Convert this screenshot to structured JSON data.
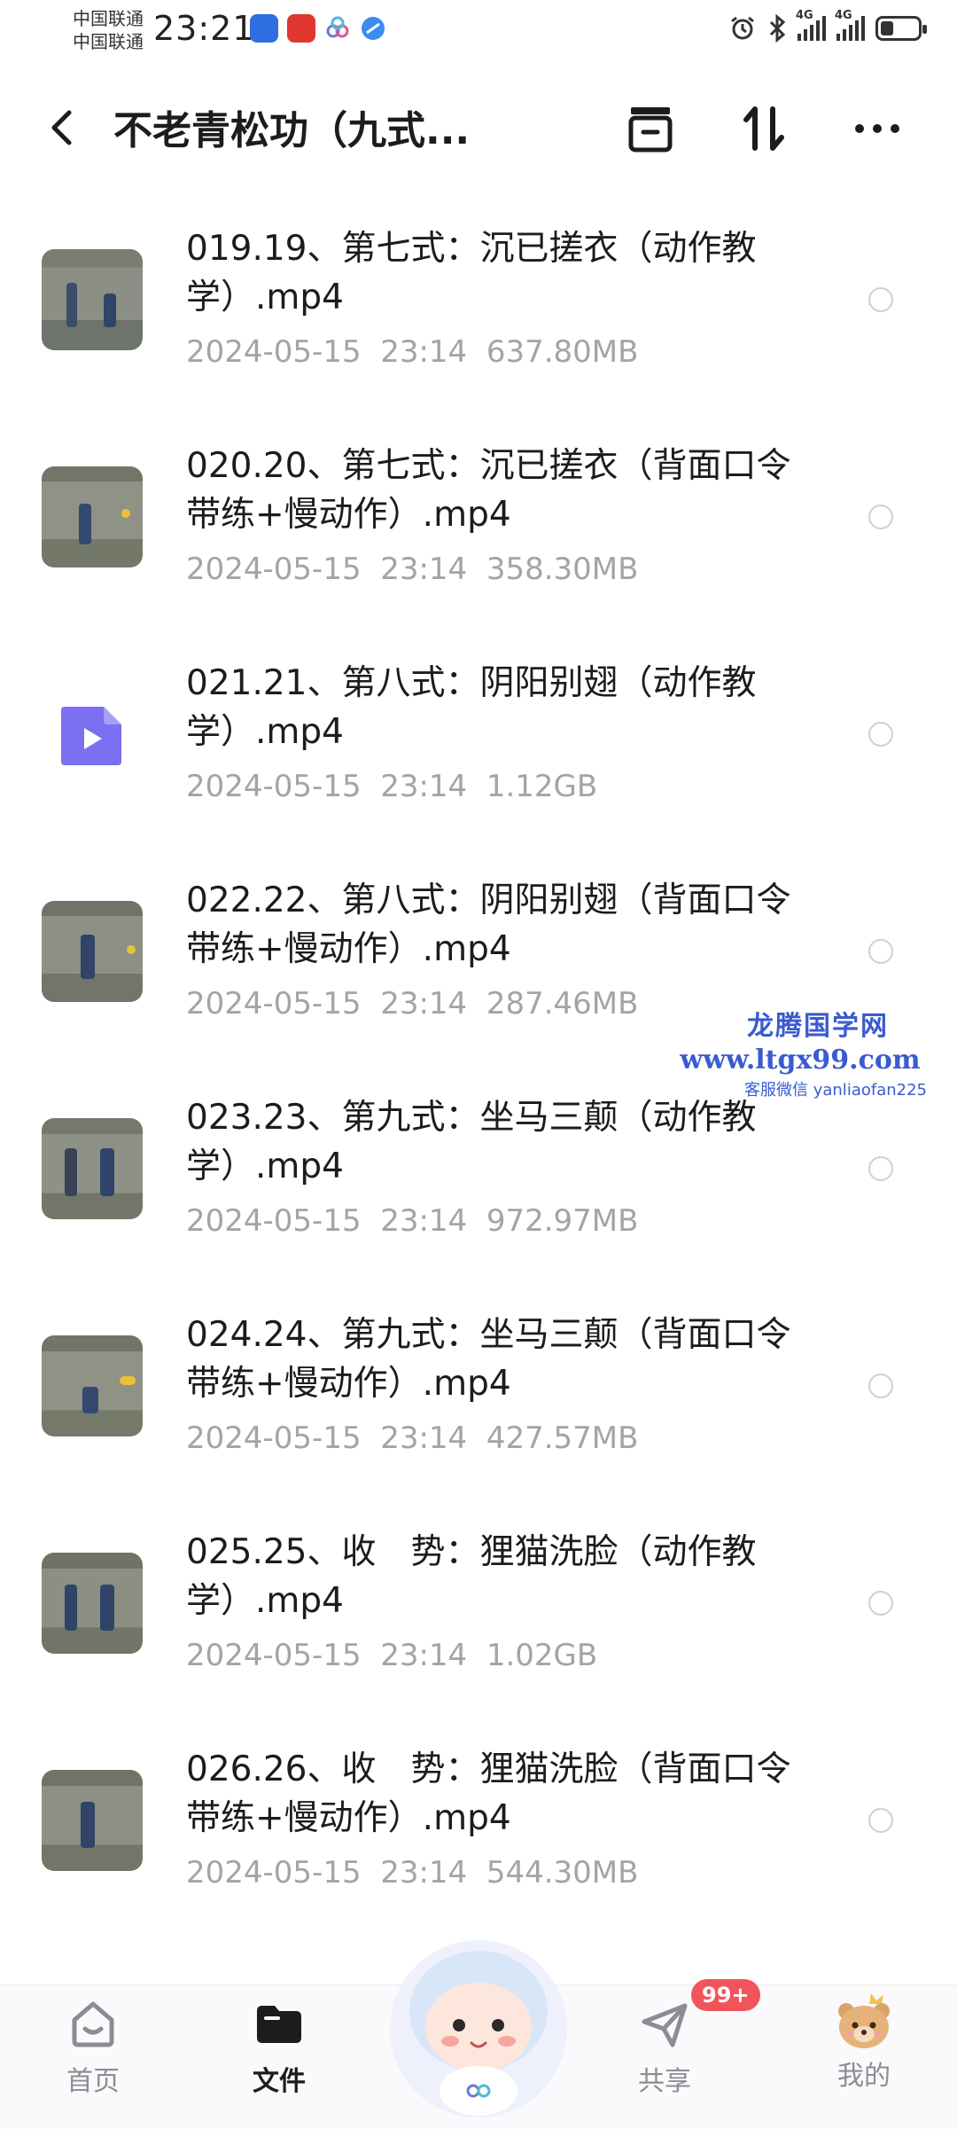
{
  "status_bar": {
    "carrier_1": "中国联通",
    "carrier_2": "中国联通",
    "time": "23:21",
    "network_1": "4G",
    "network_2": "4G"
  },
  "header": {
    "title": "不老青松功（九式..."
  },
  "files": [
    {
      "name": "019.19、第七式：沉已搓衣（动作教学）.mp4",
      "date": "2024-05-15  23:14",
      "size": "637.80MB",
      "thumb": "video"
    },
    {
      "name": "020.20、第七式：沉已搓衣（背面口令带练+慢动作）.mp4",
      "date": "2024-05-15  23:14",
      "size": "358.30MB",
      "thumb": "video"
    },
    {
      "name": "021.21、第八式：阴阳别翅（动作教学）.mp4",
      "date": "2024-05-15  23:14",
      "size": "1.12GB",
      "thumb": "file"
    },
    {
      "name": "022.22、第八式：阴阳别翅（背面口令带练+慢动作）.mp4",
      "date": "2024-05-15  23:14",
      "size": "287.46MB",
      "thumb": "video"
    },
    {
      "name": "023.23、第九式：坐马三颠（动作教学）.mp4",
      "date": "2024-05-15  23:14",
      "size": "972.97MB",
      "thumb": "video"
    },
    {
      "name": "024.24、第九式：坐马三颠（背面口令带练+慢动作）.mp4",
      "date": "2024-05-15  23:14",
      "size": "427.57MB",
      "thumb": "video"
    },
    {
      "name": "025.25、收　势：狸猫洗脸（动作教学）.mp4",
      "date": "2024-05-15  23:14",
      "size": "1.02GB",
      "thumb": "video"
    },
    {
      "name": "026.26、收　势：狸猫洗脸（背面口令带练+慢动作）.mp4",
      "date": "2024-05-15  23:14",
      "size": "544.30MB",
      "thumb": "video"
    }
  ],
  "watermark": {
    "line1": "龙腾国学网",
    "line2": "www.ltgx99.com",
    "line3": "客服微信 yanliaofan225"
  },
  "tabbar": {
    "home": "首页",
    "files": "文件",
    "share": "共享",
    "mine": "我的",
    "share_badge": "99+"
  },
  "colors": {
    "accent": "#1c1c1e",
    "meta_text": "#a3a3a8",
    "badge": "#f2545b",
    "file_icon": "#7b6ff2"
  }
}
